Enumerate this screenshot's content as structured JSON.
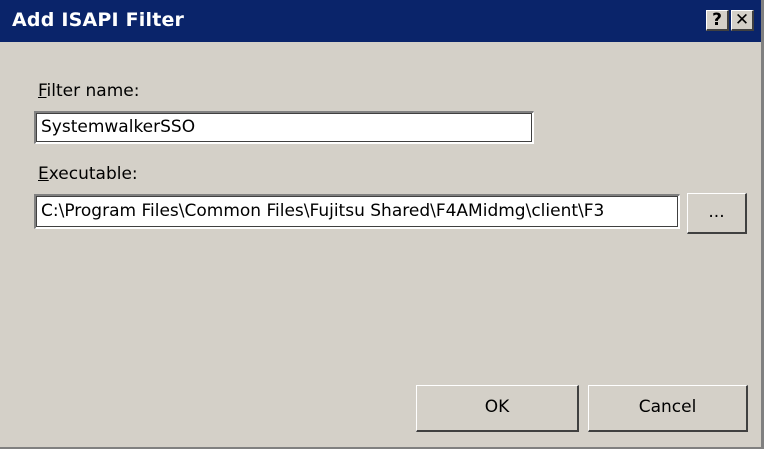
{
  "window": {
    "title": "Add ISAPI Filter",
    "help_glyph": "?",
    "close_glyph": "✕"
  },
  "form": {
    "filter_name": {
      "label_accel": "F",
      "label_rest": "ilter name:",
      "value": "SystemwalkerSSO"
    },
    "executable": {
      "label_accel": "E",
      "label_rest": "xecutable:",
      "value": "C:\\Program Files\\Common Files\\Fujitsu Shared\\F4AMidmg\\client\\F3"
    },
    "browse_label": "..."
  },
  "buttons": {
    "ok": "OK",
    "cancel": "Cancel"
  },
  "colors": {
    "titlebar": "#0a246a",
    "dialog_face": "#d4d0c8"
  }
}
